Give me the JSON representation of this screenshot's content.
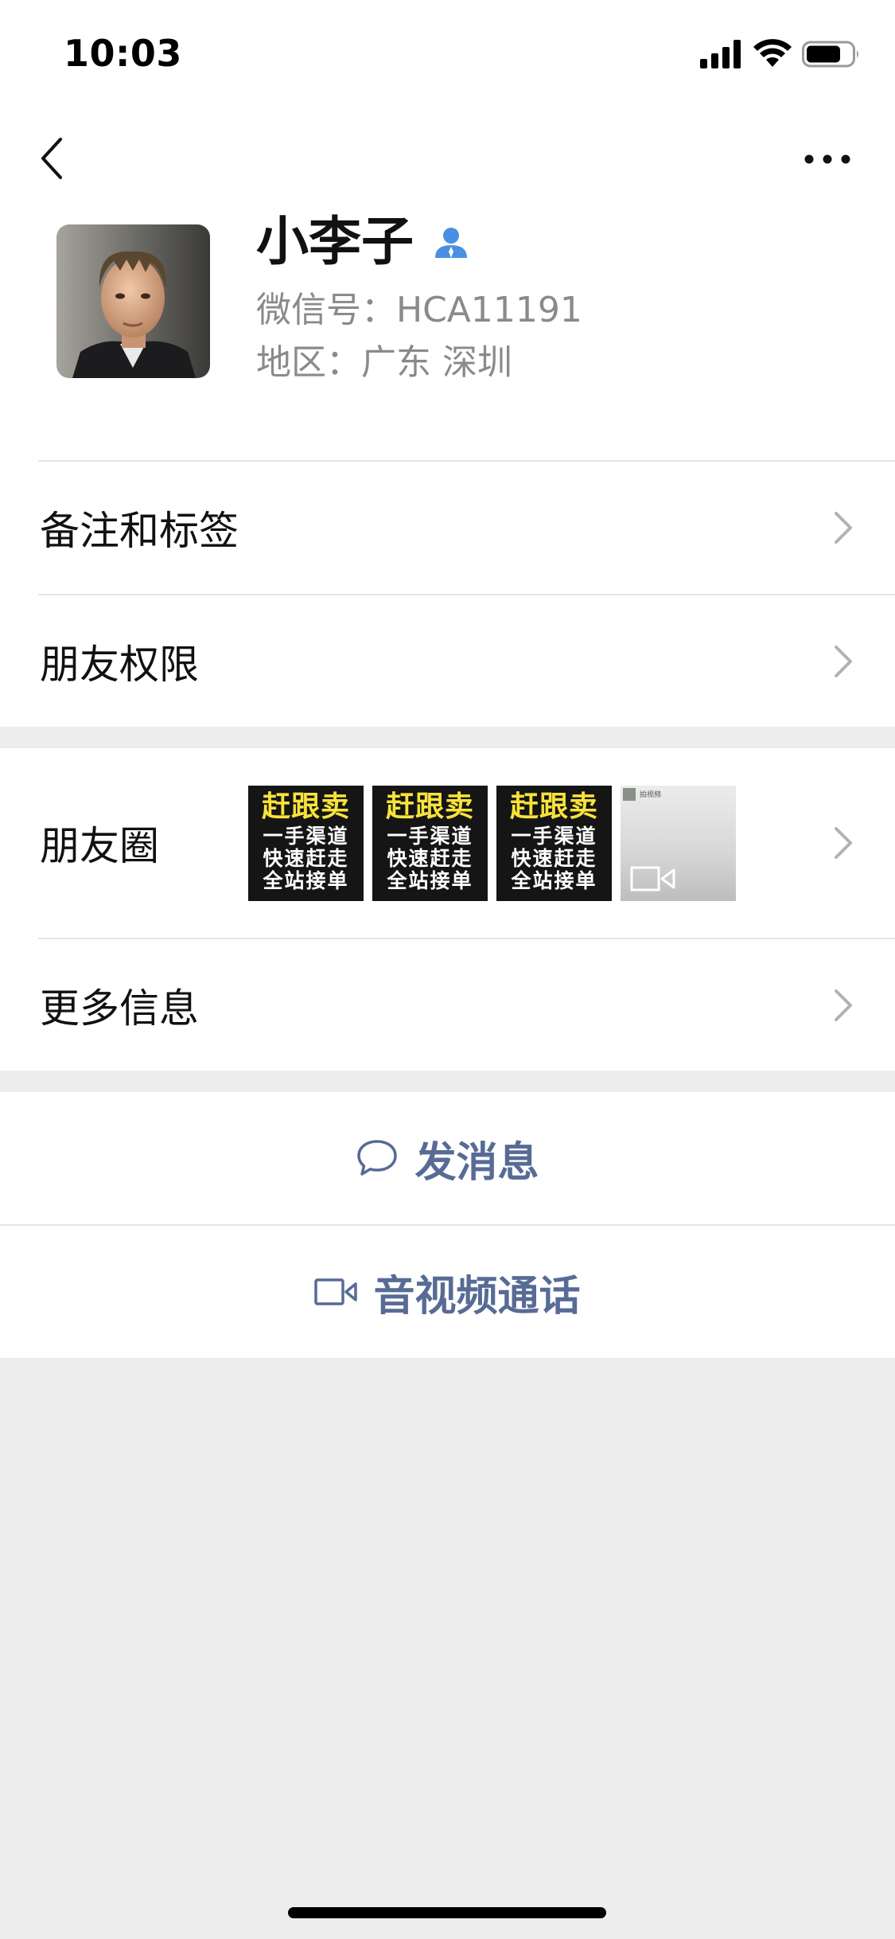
{
  "status_bar": {
    "time": "10:03"
  },
  "profile": {
    "name": "小李子",
    "wechat_id": "微信号：HCA11191",
    "region": "地区：广东 深圳"
  },
  "rows": {
    "remark_tags": "备注和标签",
    "friend_permissions": "朋友权限",
    "moments": "朋友圈",
    "more_info": "更多信息"
  },
  "moments_thumbs": [
    {
      "title": "赶跟卖",
      "lines": [
        "一手渠道",
        "快速赶走",
        "全站接单"
      ]
    },
    {
      "title": "赶跟卖",
      "lines": [
        "一手渠道",
        "快速赶走",
        "全站接单"
      ]
    },
    {
      "title": "赶跟卖",
      "lines": [
        "一手渠道",
        "快速赶走",
        "全站接单"
      ]
    }
  ],
  "video_thumb_caption": "拍视频",
  "actions": {
    "send_message": "发消息",
    "av_call": "音视频通话"
  },
  "icons": {
    "back": "chevron-left-icon",
    "more": "more-dots-icon",
    "contact_badge": "person-icon",
    "chevron": "chevron-right-icon",
    "message": "chat-bubble-icon",
    "video_call": "video-camera-icon"
  },
  "colors": {
    "link_blue": "#576b95",
    "badge_blue": "#4a90e2",
    "thumb_title_yellow": "#f7e33a",
    "background": "#ededed"
  }
}
